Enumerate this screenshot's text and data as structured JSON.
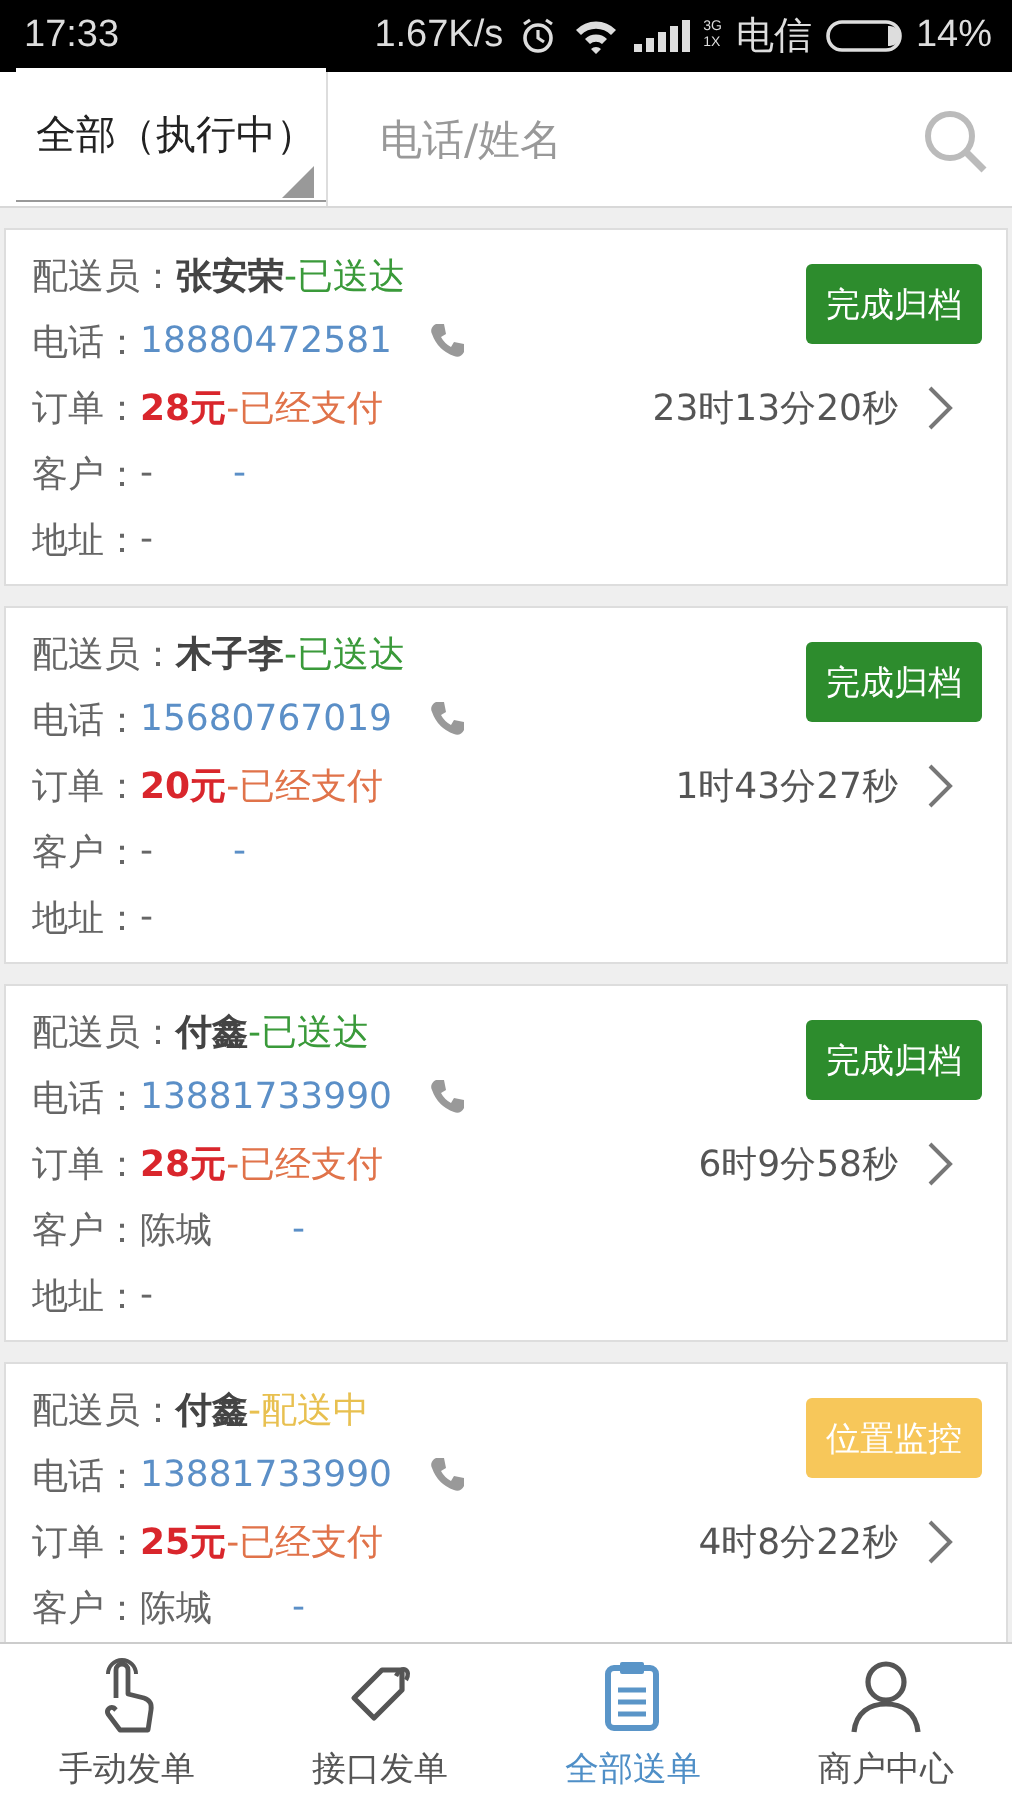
{
  "status_bar": {
    "time": "17:33",
    "speed": "1.67K/s",
    "network_top": "3G",
    "network_bottom": "1X",
    "carrier": "电信",
    "battery": "14%"
  },
  "filter": {
    "value": "全部（执行中）",
    "search_placeholder": "电话/姓名"
  },
  "orders": [
    {
      "courier_label": "配送员：",
      "courier": "张安荣",
      "status": "-已送达",
      "kind": "delivered",
      "phone_label": "电话：",
      "phone": "18880472581",
      "order_label": "订单：",
      "amount": "28元",
      "payment": "-已经支付",
      "timer": "23时13分20秒",
      "customer_label": "客户：",
      "customer": "-",
      "customer_extra": "-",
      "address_label": "地址：",
      "address": "-",
      "action": "完成归档"
    },
    {
      "courier_label": "配送员：",
      "courier": "木子李",
      "status": "-已送达",
      "kind": "delivered",
      "phone_label": "电话：",
      "phone": "15680767019",
      "order_label": "订单：",
      "amount": "20元",
      "payment": "-已经支付",
      "timer": "1时43分27秒",
      "customer_label": "客户：",
      "customer": "-",
      "customer_extra": "-",
      "address_label": "地址：",
      "address": "-",
      "action": "完成归档"
    },
    {
      "courier_label": "配送员：",
      "courier": "付鑫",
      "status": "-已送达",
      "kind": "delivered",
      "phone_label": "电话：",
      "phone": "13881733990",
      "order_label": "订单：",
      "amount": "28元",
      "payment": "-已经支付",
      "timer": "6时9分58秒",
      "customer_label": "客户：",
      "customer": "陈城",
      "customer_extra": "-",
      "address_label": "地址：",
      "address": "-",
      "action": "完成归档"
    },
    {
      "courier_label": "配送员：",
      "courier": "付鑫",
      "status": "-配送中",
      "kind": "delivering",
      "phone_label": "电话：",
      "phone": "13881733990",
      "order_label": "订单：",
      "amount": "25元",
      "payment": "-已经支付",
      "timer": "4时8分22秒",
      "customer_label": "客户：",
      "customer": "陈城",
      "customer_extra": "-",
      "action": "位置监控"
    }
  ],
  "tabs": [
    {
      "label": "手动发单",
      "selected": false
    },
    {
      "label": "接口发单",
      "selected": false
    },
    {
      "label": "全部送单",
      "selected": true
    },
    {
      "label": "商户中心",
      "selected": false
    }
  ]
}
